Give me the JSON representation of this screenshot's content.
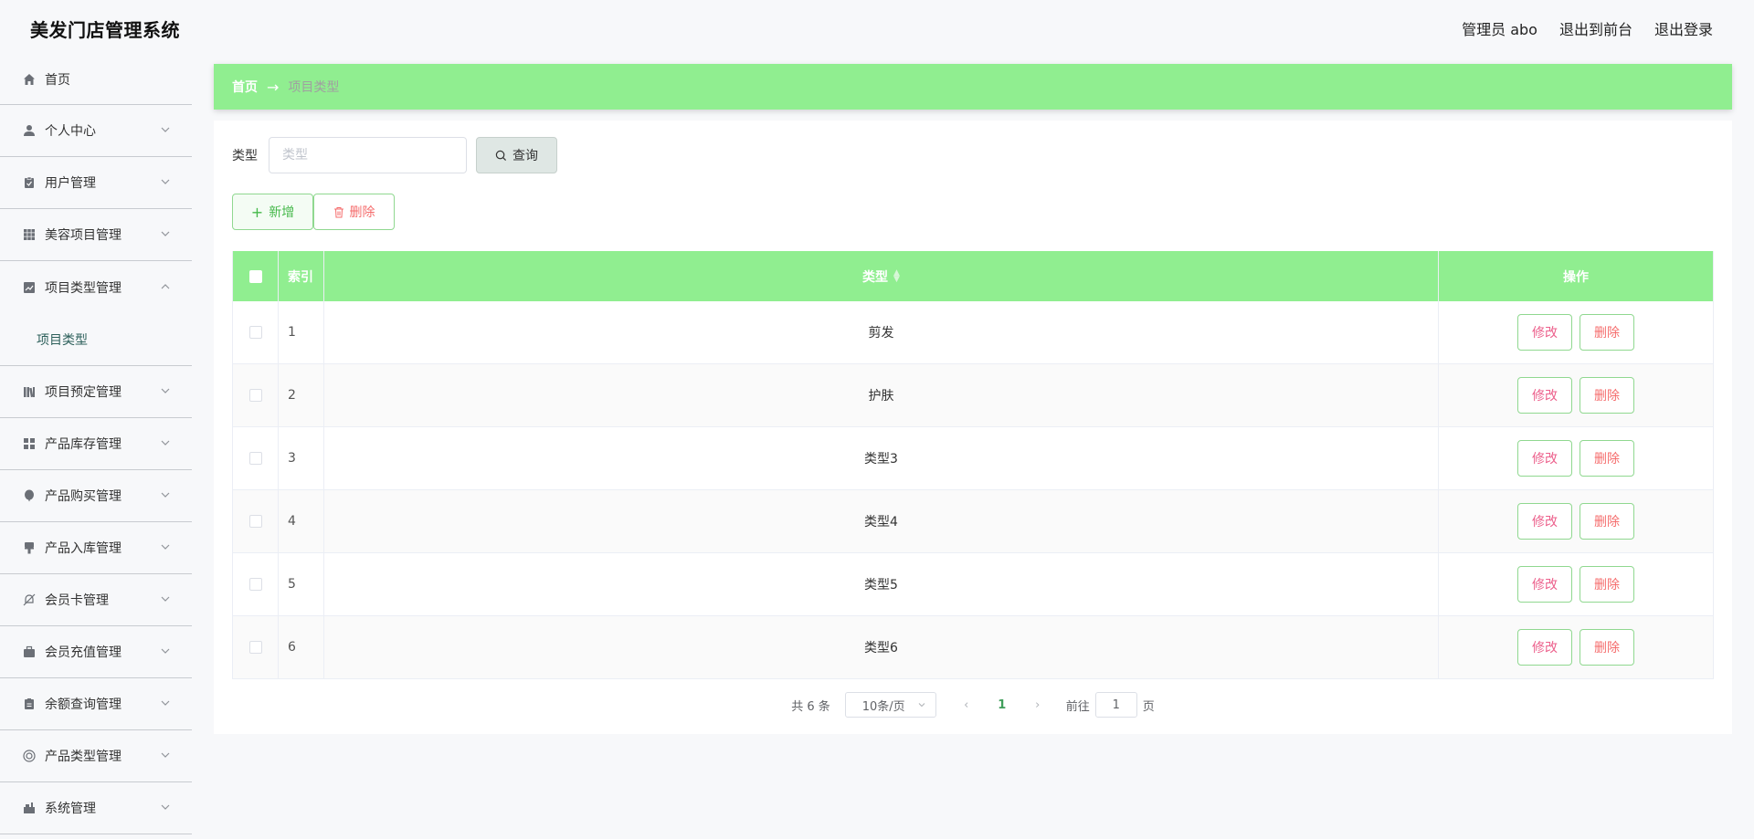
{
  "header": {
    "app_title": "美发门店管理系统",
    "admin_label": "管理员 abo",
    "front_link": "退出到前台",
    "logout_link": "退出登录"
  },
  "sidebar": {
    "items": [
      {
        "label": "首页",
        "icon": "home-icon"
      },
      {
        "label": "个人中心",
        "icon": "user-icon"
      },
      {
        "label": "用户管理",
        "icon": "clipboard-icon"
      },
      {
        "label": "美容项目管理",
        "icon": "grid-icon"
      },
      {
        "label": "项目类型管理",
        "icon": "chart-icon",
        "expanded": true,
        "sub": [
          "项目类型"
        ]
      },
      {
        "label": "项目预定管理",
        "icon": "library-icon"
      },
      {
        "label": "产品库存管理",
        "icon": "apps-icon"
      },
      {
        "label": "产品购买管理",
        "icon": "balloon-icon"
      },
      {
        "label": "产品入库管理",
        "icon": "brush-icon"
      },
      {
        "label": "会员卡管理",
        "icon": "bell-off-icon"
      },
      {
        "label": "会员充值管理",
        "icon": "briefcase-icon"
      },
      {
        "label": "余额查询管理",
        "icon": "document-icon"
      },
      {
        "label": "产品类型管理",
        "icon": "lifebuoy-icon"
      },
      {
        "label": "系统管理",
        "icon": "settings-icon"
      }
    ]
  },
  "breadcrumb": {
    "home": "首页",
    "current": "项目类型"
  },
  "search": {
    "label": "类型",
    "placeholder": "类型",
    "button": "查询"
  },
  "actions": {
    "add": "新增",
    "delete": "删除"
  },
  "table": {
    "headers": {
      "index": "索引",
      "type": "类型",
      "op": "操作"
    },
    "rows": [
      {
        "index": "1",
        "type": "剪发"
      },
      {
        "index": "2",
        "type": "护肤"
      },
      {
        "index": "3",
        "type": "类型3"
      },
      {
        "index": "4",
        "type": "类型4"
      },
      {
        "index": "5",
        "type": "类型5"
      },
      {
        "index": "6",
        "type": "类型6"
      }
    ],
    "edit_label": "修改",
    "delete_label": "删除"
  },
  "pagination": {
    "total": "共 6 条",
    "page_size": "10条/页",
    "current_page": "1",
    "goto_prefix": "前往",
    "goto_value": "1",
    "goto_suffix": "页"
  },
  "colors": {
    "accent_green": "#90ee90",
    "delete_red": "#f56c6c",
    "edit_pink": "#ec5f8b"
  }
}
